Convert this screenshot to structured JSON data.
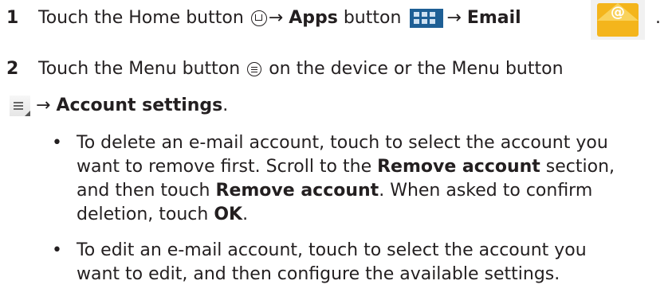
{
  "step1": {
    "number": "1",
    "text_before": "Touch the Home button",
    "arrow1": "→",
    "apps": "Apps",
    "button_word": "button",
    "arrow2": "→",
    "email": "Email",
    "period": "."
  },
  "step2": {
    "number": "2",
    "line1": "Touch the Menu button",
    "line1_after": "on the device or the Menu button",
    "arrow": "→",
    "account_settings": "Account settings",
    "period": "."
  },
  "bullets": [
    {
      "symbol": "•",
      "l1": "To delete an e-mail account, touch to select the account you",
      "l2a": "want to remove first. Scroll to the ",
      "l2b": "Remove account",
      "l2c": " section,",
      "l3a": "and then touch ",
      "l3b": "Remove account",
      "l3c": ". When asked to confirm",
      "l4a": "deletion, touch ",
      "l4b": "OK",
      "l4c": "."
    },
    {
      "symbol": "•",
      "l1": "To edit an e-mail account, touch to select the account you",
      "l2": "want to edit, and then configure the available settings."
    }
  ],
  "icons": {
    "home": "home-icon",
    "apps": "apps-grid-icon",
    "email": "email-envelope-icon",
    "menu_hardware": "menu-circle-icon",
    "menu_software": "menu-button-icon"
  },
  "colors": {
    "text": "#231f20",
    "apps_icon": "#1e5f95",
    "email_icon": "#f4b51c"
  }
}
